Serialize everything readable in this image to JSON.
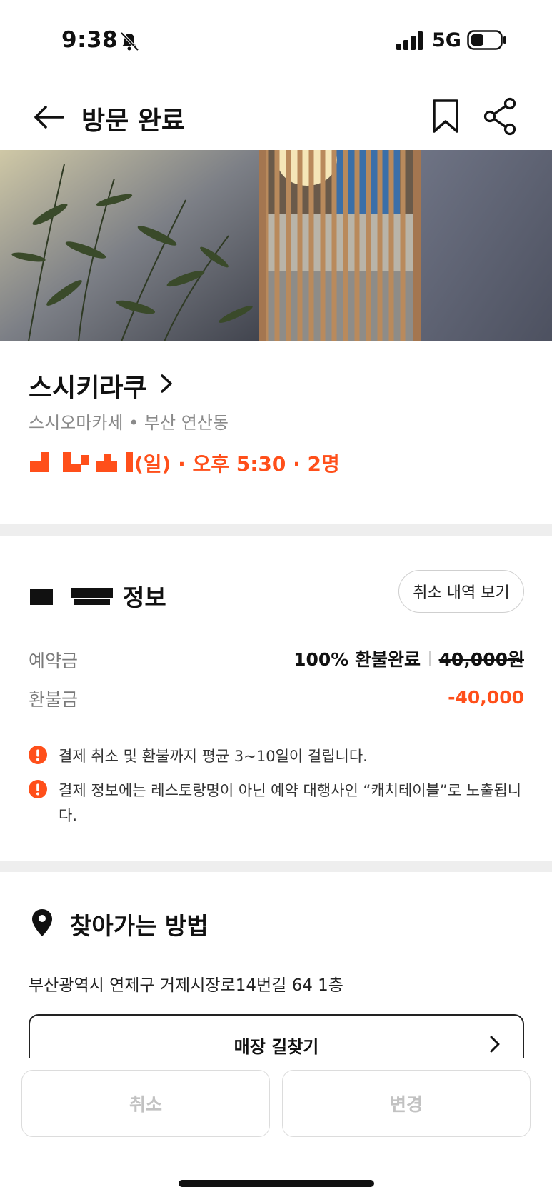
{
  "status_bar": {
    "time": "9:38",
    "network": "5G"
  },
  "header": {
    "title": "방문 완료"
  },
  "restaurant": {
    "name": "스시키라쿠",
    "category": "스시오마카세",
    "location": "부산 연산동",
    "reservation_detail": "(일) · 오후 5:30 · 2명"
  },
  "payment": {
    "title": "정보",
    "cancel_history_label": "취소 내역 보기",
    "deposit_label": "예약금",
    "refund_status": "100% 환불완료",
    "original_amount": "40,000원",
    "refund_label": "환불금",
    "refund_amount": "-40,000",
    "notices": [
      "결제 취소 및 환불까지 평균 3~10일이 걸립니다.",
      "결제 정보에는 레스토랑명이 아닌 예약 대행사인 “캐치테이블”로 노출됩니다."
    ]
  },
  "directions": {
    "title": "찾아가는 방법",
    "address": "부산광역시 연제구 거제시장로14번길 64 1층",
    "route_button_label": "매장 길찾기"
  },
  "bottom": {
    "cancel_label": "취소",
    "change_label": "변경"
  },
  "colors": {
    "accent": "#ff4f1a",
    "divider": "#eeeeee"
  }
}
